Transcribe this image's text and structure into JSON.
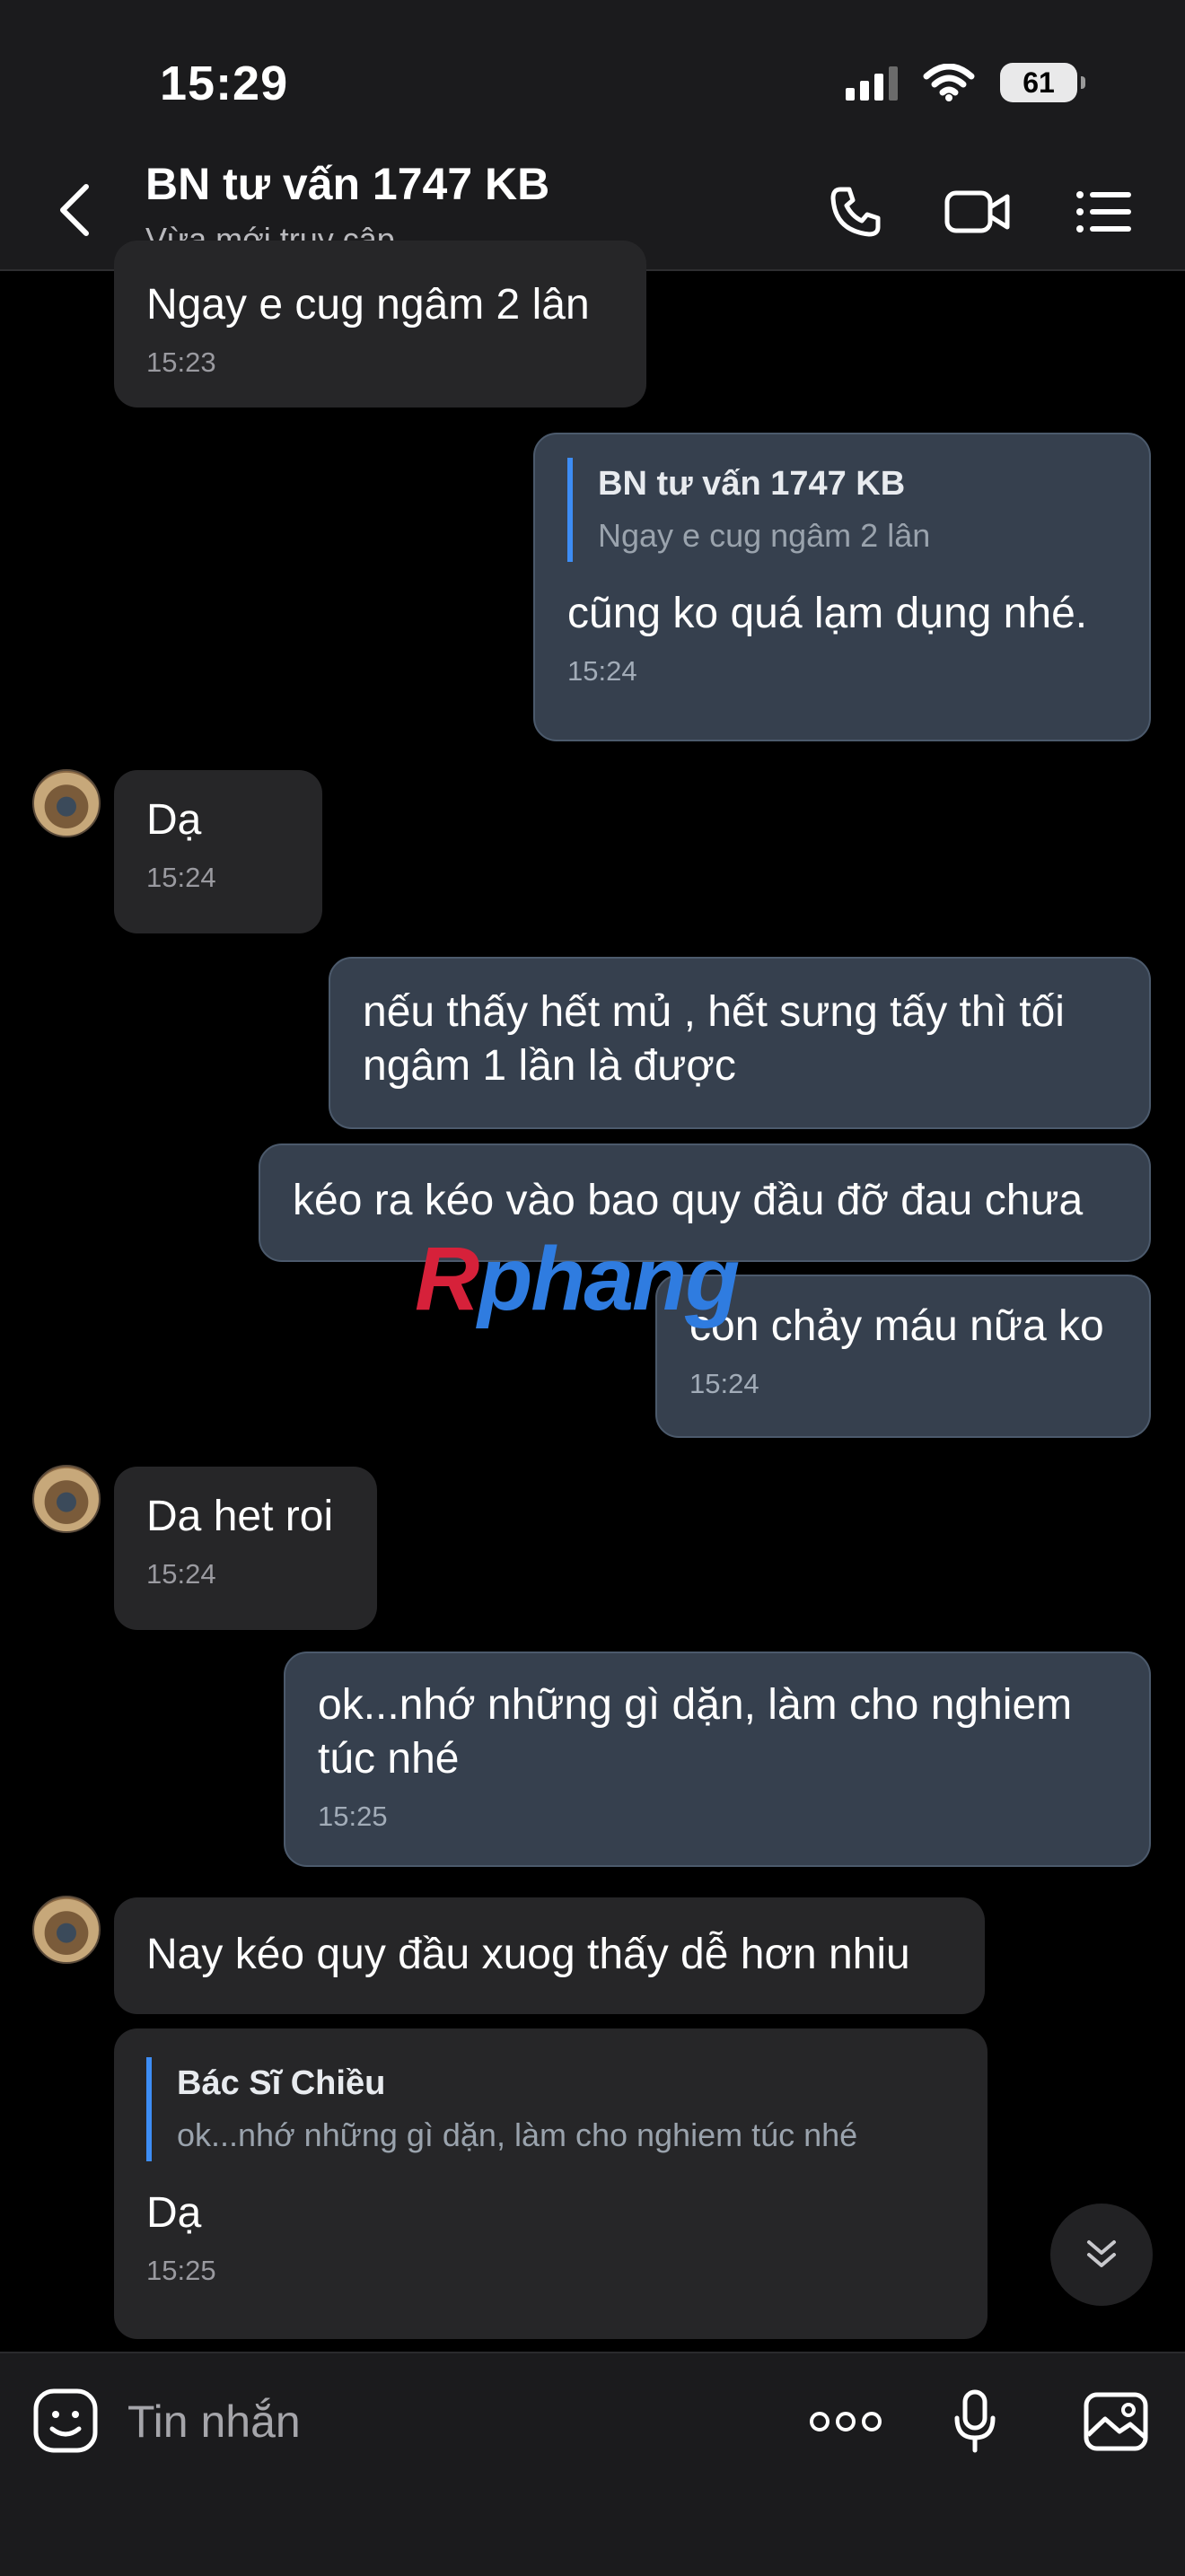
{
  "status_bar": {
    "time": "15:29",
    "battery": "61"
  },
  "header": {
    "title": "BN tư vấn 1747 KB",
    "subtitle": "Vừa mới truy cập",
    "icons": [
      "back-arrow-icon",
      "phone-icon",
      "video-call-icon",
      "list-menu-icon"
    ]
  },
  "messages": [
    {
      "side": "in",
      "text": "Ngay e cug ngâm 2 lân",
      "time": "15:23"
    },
    {
      "side": "out",
      "quote_name": "BN tư vấn 1747 KB",
      "quote_text": "Ngay e cug ngâm 2 lân",
      "text": "cũng ko quá lạm dụng nhé.",
      "time": "15:24"
    },
    {
      "side": "in",
      "text": "Dạ",
      "time": "15:24"
    },
    {
      "side": "out",
      "text": "nếu thấy hết mủ , hết sưng tấy thì tối ngâm 1 lần là được"
    },
    {
      "side": "out",
      "text": "kéo ra kéo vào bao quy đầu đỡ đau chưa"
    },
    {
      "side": "out",
      "text": "còn chảy máu nữa ko",
      "time": "15:24"
    },
    {
      "side": "in",
      "text": "Da het roi",
      "time": "15:24"
    },
    {
      "side": "out",
      "text": "ok...nhớ những gì dặn, làm cho nghiem túc nhé",
      "time": "15:25"
    },
    {
      "side": "in",
      "text": "Nay kéo quy đầu xuog thấy dễ hơn nhiu"
    },
    {
      "side": "in",
      "quote_name": "Bác Sĩ Chiều",
      "quote_text": "ok...nhớ những gì dặn, làm cho nghiem túc nhé",
      "text": "Dạ",
      "time": "15:25"
    }
  ],
  "watermark": {
    "part1": "R",
    "part2": "phang"
  },
  "composer": {
    "placeholder": "Tin nhắn",
    "icons": [
      "emoji-icon",
      "more-icon",
      "microphone-icon",
      "image-icon"
    ]
  },
  "colors": {
    "incoming_bubble": "#262628",
    "outgoing_bubble": "#36404e",
    "quote_bar": "#3d8df5",
    "background": "#000000"
  }
}
